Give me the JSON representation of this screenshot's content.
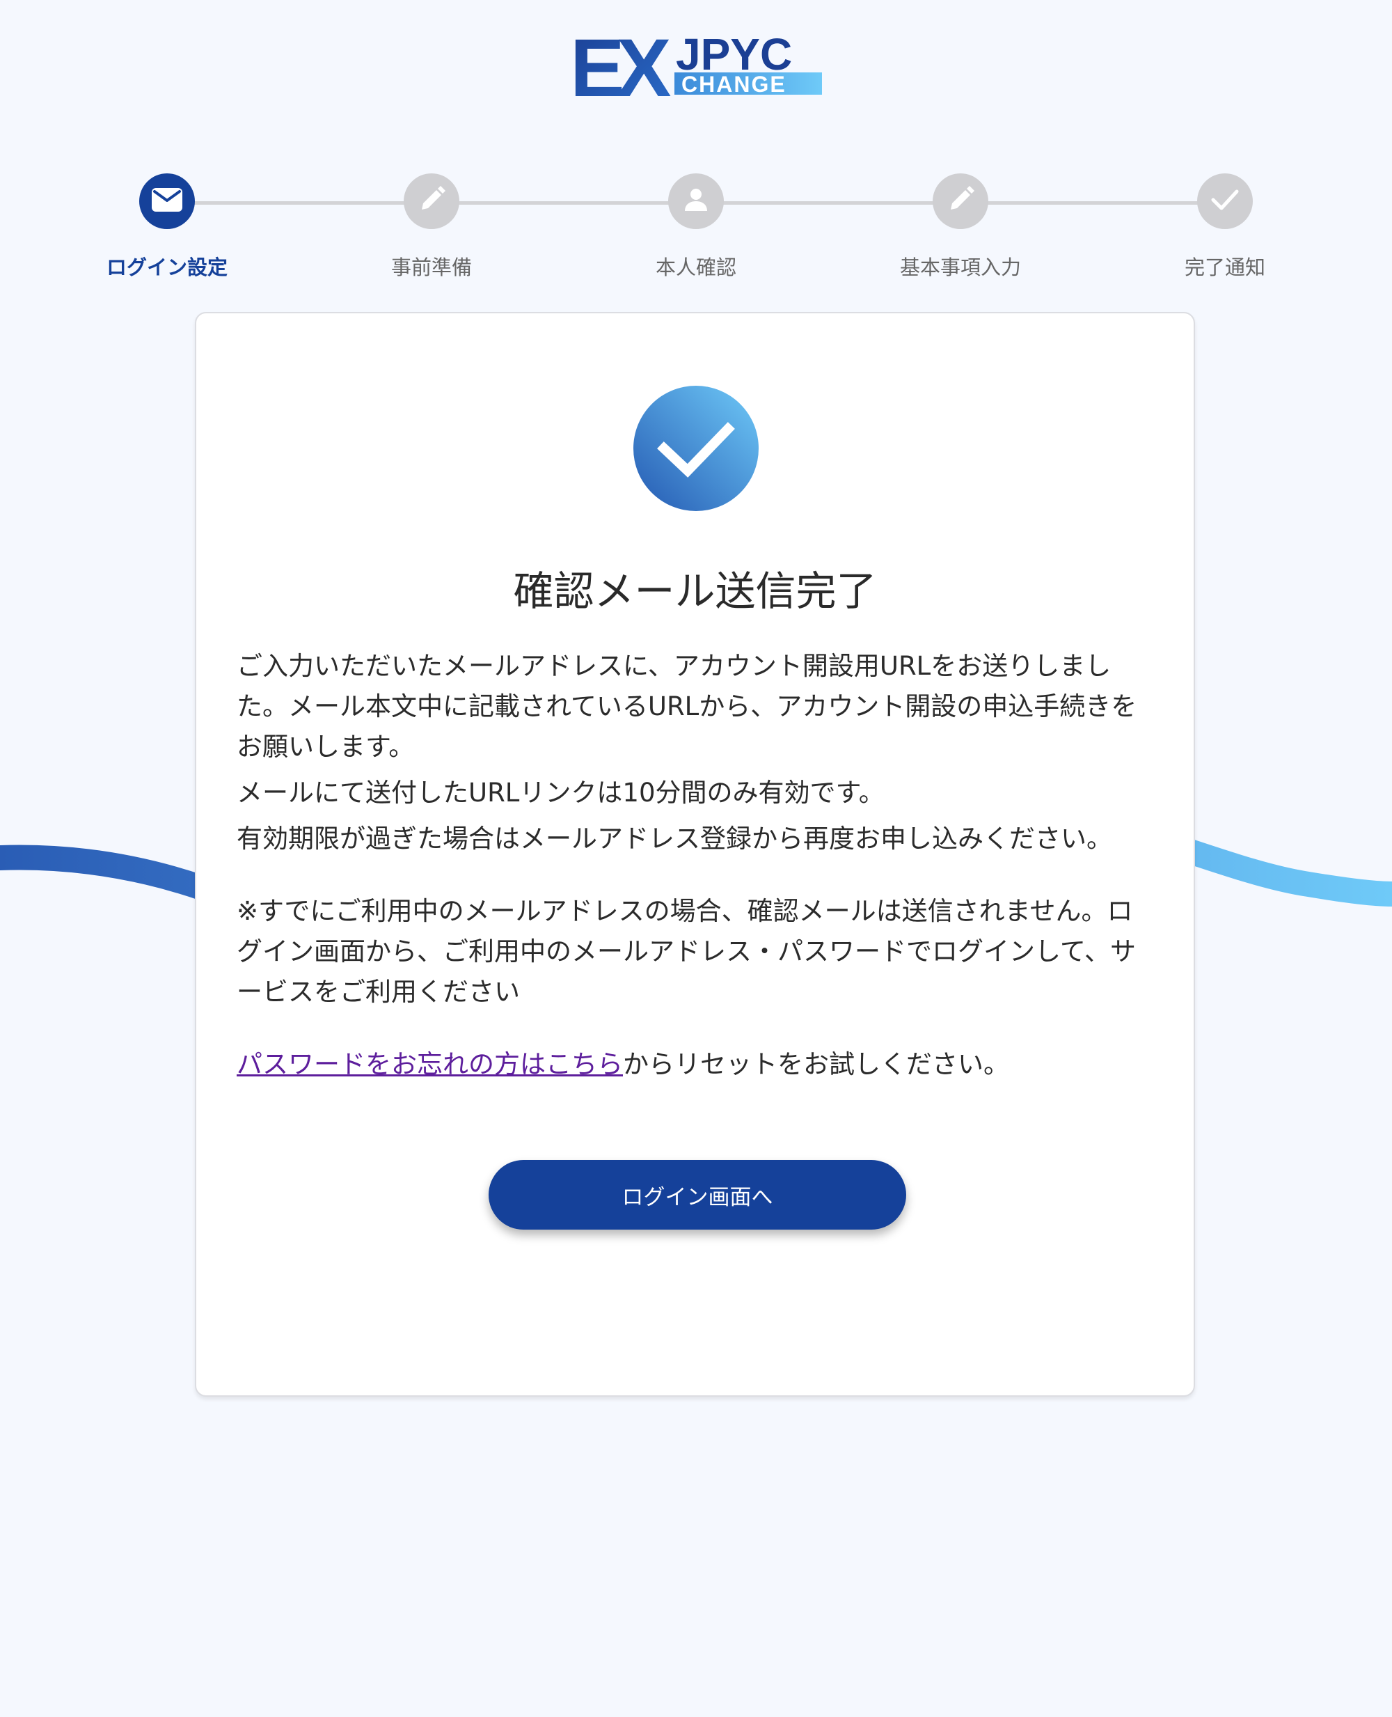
{
  "header": {
    "logo_text_main": "EX",
    "logo_text_top": "JPYC",
    "logo_text_bottom": "CHANGE"
  },
  "stepper": {
    "steps": [
      {
        "label": "ログイン設定",
        "icon": "mail-icon",
        "active": true
      },
      {
        "label": "事前準備",
        "icon": "pencil-icon",
        "active": false
      },
      {
        "label": "本人確認",
        "icon": "person-icon",
        "active": false
      },
      {
        "label": "基本事項入力",
        "icon": "pencil-icon",
        "active": false
      },
      {
        "label": "完了通知",
        "icon": "check-icon",
        "active": false
      }
    ]
  },
  "card": {
    "title": "確認メール送信完了",
    "paragraph1": "ご入力いただいたメールアドレスに、アカウント開設用URLをお送りしました。メール本文中に記載されているURLから、アカウント開設の申込手続きをお願いします。",
    "paragraph2": "メールにて送付したURLリンクは10分間のみ有効です。",
    "paragraph3": "有効期限が過ぎた場合はメールアドレス登録から再度お申し込みください。",
    "paragraph4": "※すでにご利用中のメールアドレスの場合、確認メールは送信されません。ログイン画面から、ご利用中のメールアドレス・パスワードでログインして、サービスをご利用ください",
    "reset_link": "パスワードをお忘れの方はこちら",
    "reset_suffix": "からリセットをお試しください。",
    "login_button": "ログイン画面へ"
  },
  "colors": {
    "primary": "#15419a",
    "inactive_step": "#cfcfd2",
    "background": "#f5f8fe",
    "link": "#5d1e9c",
    "wave_light": "#6fcaf8"
  }
}
